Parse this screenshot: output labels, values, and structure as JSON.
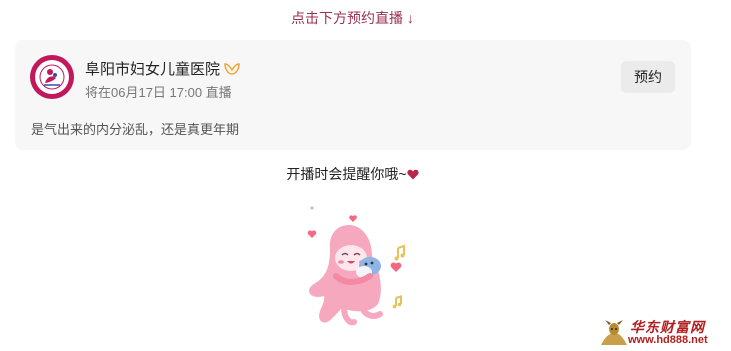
{
  "header": {
    "prompt": "点击下方预约直播 ↓"
  },
  "live_card": {
    "org_name": "阜阳市妇女儿童医院",
    "schedule": "将在06月17日 17:00 直播",
    "description": "是气出来的内分泌乱，还是真更年期",
    "reserve_label": "预约",
    "verified_icon": "verified-badge-icon"
  },
  "reminder": {
    "text": "开播时会提醒你哦~"
  },
  "sticker": {
    "icon": "pink-mascot-sticker"
  },
  "watermark": {
    "brand": "华东财富网",
    "url": "www.hd888.net"
  },
  "colors": {
    "accent": "#9c2f55",
    "card_bg": "#f7f7f7",
    "button_bg": "#ebebeb",
    "avatar_ring": "#c2185b",
    "watermark_red": "#b02020"
  }
}
